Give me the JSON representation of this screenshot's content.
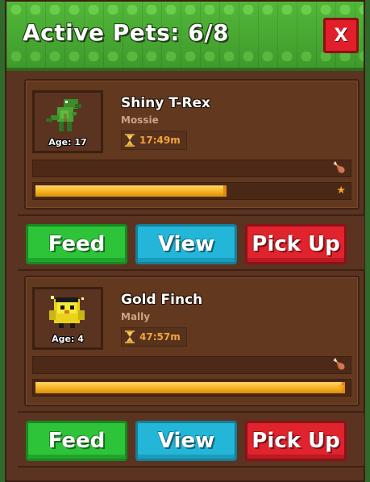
{
  "header": {
    "title": "Active Pets: 6/8",
    "close_label": "X"
  },
  "pets": [
    {
      "name": "Shiny T-Rex",
      "owner": "Mossie",
      "age_label": "Age: 17",
      "timer": "17:49m",
      "food_fraction": 0,
      "xp_fraction": 0.6,
      "thumbnail": "green-trex-icon",
      "actions": {
        "feed": "Feed",
        "view": "View",
        "pickup": "Pick Up"
      }
    },
    {
      "name": "Gold Finch",
      "owner": "Mally",
      "age_label": "Age: 4",
      "timer": "47:57m",
      "food_fraction": 0,
      "xp_fraction": 0.98,
      "thumbnail": "gold-finch-icon",
      "actions": {
        "feed": "Feed",
        "view": "View",
        "pickup": "Pick Up"
      }
    }
  ],
  "icons": {
    "food": "meat-drumstick-icon",
    "xp": "star-icon",
    "timer": "hourglass-icon"
  },
  "colors": {
    "header_green": "#4caf35",
    "feed_green": "#2ec43a",
    "view_blue": "#23b6d8",
    "pickup_red": "#e0232c",
    "close_red": "#e01f2a",
    "timer_orange": "#f2a43a"
  }
}
